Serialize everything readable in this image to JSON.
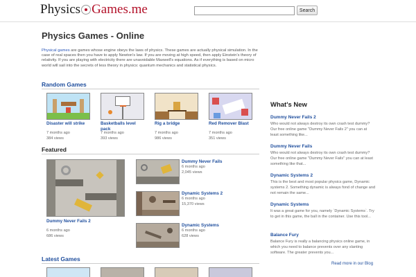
{
  "header": {
    "logo_part1": "Physics",
    "logo_part2": "Games.me",
    "search_placeholder": "",
    "search_button": "Search"
  },
  "main": {
    "title": "Physics Games - Online",
    "intro_link": "Physical games",
    "intro_text": " are games whose engine obeys the laws of physics. These games are actually physical simulation. In the case of real spaces then you have to apply Newton's law. If you are moving at high speed, then apply Einstein's theory of relativity. If you are playing with electricity there are unavoidable Maxwell's equations. As if everything is based on micro world will sail into the secrets of less theory in physics: quantum mechanics and statistical physics."
  },
  "random_games": {
    "heading": "Random Games",
    "items": [
      {
        "name": "Disaster will strike",
        "date": "7 months ago",
        "views": "384 views"
      },
      {
        "name": "Basketballs level pack",
        "date": "7 months ago",
        "views": "393 views"
      },
      {
        "name": "Rig a bridge",
        "date": "7 months ago",
        "views": "986 views"
      },
      {
        "name": "Red Remover Blast",
        "date": "7 months ago",
        "views": "351 views"
      }
    ]
  },
  "featured": {
    "heading": "Featured",
    "main": {
      "name": "Dummy Never Fails 2",
      "date": "6 months ago",
      "views": "686 views"
    },
    "items": [
      {
        "name": "Dummy Never Fails",
        "date": "6 months ago",
        "views": "2,045 views"
      },
      {
        "name": "Dynamic Systems 2",
        "date": "6 months ago",
        "views": "15,370 views"
      },
      {
        "name": "Dynamic Systems",
        "date": "6 months ago",
        "views": "628 views"
      }
    ]
  },
  "latest": {
    "heading": "Latest Games"
  },
  "sidebar": {
    "heading": "What's New",
    "items": [
      {
        "title": "Dummy Never Fails 2",
        "text": "Who would not always destroy its own crash test dummy? Our free online game \"Dummy Never Fails 2\" you can at least something like..."
      },
      {
        "title": "Dummy Never Fails",
        "text": "Who would not always destroy its own crash test dummy? Our free online game \"Dummy Never Fails\" you can at least something like that..."
      },
      {
        "title": "Dynamic Systems 2",
        "text": "This is the best and most popular physics game, Dynamic systems 2. Something dynamic is always fond of change and not remain the same..."
      },
      {
        "title": "Dynamic Systems",
        "text": "It was a great game for you, namely `Dynamic Systems`. Try to get in this game, the ball in the container. Use this tool..."
      },
      {
        "title": "Balance Fury",
        "text": "Balance Fury is really a balancing physics online game, in which you need to balance prevents over any slanting software. The greater prevents you..."
      }
    ],
    "read_more": "Read more in our Blog"
  },
  "colors": {
    "link": "#1f4e9d",
    "brand_red": "#b3122a"
  },
  "icons": {
    "logo_mark": "atom-icon"
  }
}
